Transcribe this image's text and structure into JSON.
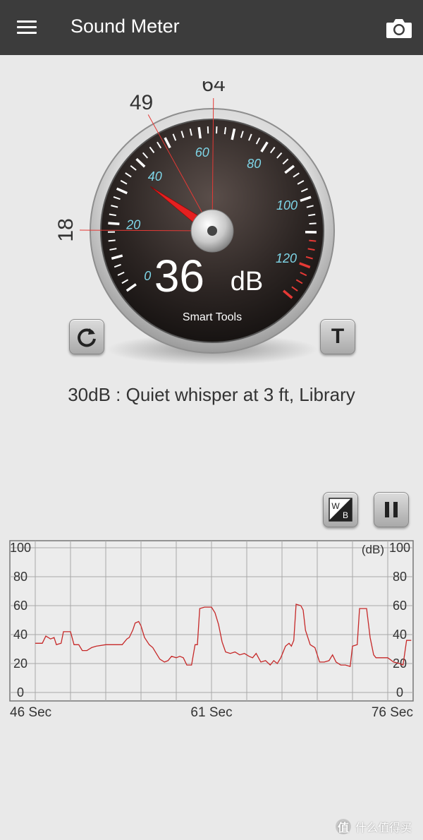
{
  "app_bar": {
    "title": "Sound Meter",
    "menu_icon": "hamburger-menu-icon",
    "camera_icon": "camera-icon"
  },
  "gauge": {
    "reading_value": "36",
    "reading_unit": "dB",
    "brand": "Smart Tools",
    "scale_labels": [
      "0",
      "20",
      "40",
      "60",
      "80",
      "100",
      "120"
    ],
    "min_marker": "18",
    "avg_marker": "49",
    "max_marker": "64",
    "needle_db": 36,
    "min_db": 18,
    "avg_db": 49,
    "max_db": 64,
    "needle_color": "#e52020",
    "scale_color": "#7fd6e8"
  },
  "buttons": {
    "reset_icon": "refresh-icon",
    "t_label": "T",
    "wb_top": "W",
    "wb_bottom": "B",
    "pause_icon": "pause-icon"
  },
  "status": {
    "description": "30dB : Quiet whisper at 3 ft, Library"
  },
  "chart_data": {
    "type": "line",
    "unit_label": "(dB)",
    "ylim": [
      0,
      100
    ],
    "y_ticks": [
      "0",
      "20",
      "40",
      "60",
      "80",
      "100"
    ],
    "x_labels": [
      "46 Sec",
      "61 Sec",
      "76 Sec"
    ],
    "xlim": [
      46,
      76
    ],
    "grid": true,
    "line_color": "#c62828",
    "series": [
      {
        "values": [
          [
            46.0,
            34
          ],
          [
            46.6,
            34
          ],
          [
            46.9,
            39
          ],
          [
            47.3,
            37
          ],
          [
            47.6,
            38
          ],
          [
            47.8,
            33
          ],
          [
            48.2,
            34
          ],
          [
            48.4,
            42
          ],
          [
            49.0,
            42
          ],
          [
            49.3,
            33
          ],
          [
            49.7,
            33
          ],
          [
            50.0,
            29
          ],
          [
            50.4,
            29
          ],
          [
            50.8,
            31
          ],
          [
            51.2,
            32
          ],
          [
            52.0,
            33
          ],
          [
            53.0,
            33
          ],
          [
            53.4,
            33
          ],
          [
            53.8,
            37
          ],
          [
            54.0,
            38
          ],
          [
            54.3,
            43
          ],
          [
            54.5,
            48
          ],
          [
            54.8,
            49
          ],
          [
            55.0,
            46
          ],
          [
            55.3,
            38
          ],
          [
            55.7,
            33
          ],
          [
            56.0,
            31
          ],
          [
            56.3,
            27
          ],
          [
            56.6,
            23
          ],
          [
            57.0,
            21
          ],
          [
            57.3,
            22
          ],
          [
            57.6,
            25
          ],
          [
            58.0,
            24
          ],
          [
            58.3,
            25
          ],
          [
            58.6,
            24
          ],
          [
            58.9,
            19
          ],
          [
            59.3,
            19
          ],
          [
            59.6,
            33
          ],
          [
            59.8,
            33
          ],
          [
            60.0,
            58
          ],
          [
            60.4,
            59
          ],
          [
            61.0,
            59
          ],
          [
            61.3,
            55
          ],
          [
            61.6,
            47
          ],
          [
            61.9,
            35
          ],
          [
            62.2,
            28
          ],
          [
            62.6,
            27
          ],
          [
            63.0,
            28
          ],
          [
            63.4,
            26
          ],
          [
            63.8,
            27
          ],
          [
            64.2,
            25
          ],
          [
            64.5,
            24
          ],
          [
            64.8,
            27
          ],
          [
            65.2,
            21
          ],
          [
            65.6,
            22
          ],
          [
            66.0,
            19
          ],
          [
            66.3,
            22
          ],
          [
            66.6,
            20
          ],
          [
            66.9,
            24
          ],
          [
            67.3,
            32
          ],
          [
            67.6,
            34
          ],
          [
            67.8,
            32
          ],
          [
            68.0,
            36
          ],
          [
            68.2,
            61
          ],
          [
            68.6,
            60
          ],
          [
            68.8,
            57
          ],
          [
            69.0,
            43
          ],
          [
            69.4,
            33
          ],
          [
            69.8,
            31
          ],
          [
            70.2,
            21
          ],
          [
            70.6,
            21
          ],
          [
            71.0,
            22
          ],
          [
            71.3,
            26
          ],
          [
            71.6,
            21
          ],
          [
            72.0,
            19
          ],
          [
            72.4,
            19
          ],
          [
            72.8,
            18
          ],
          [
            73.0,
            32
          ],
          [
            73.4,
            33
          ],
          [
            73.6,
            58
          ],
          [
            74.2,
            58
          ],
          [
            74.5,
            38
          ],
          [
            74.8,
            26
          ],
          [
            75.0,
            24
          ],
          [
            75.5,
            24
          ],
          [
            76.0,
            24
          ],
          [
            76.5,
            21
          ],
          [
            77.0,
            20
          ],
          [
            77.3,
            19
          ],
          [
            77.6,
            36
          ],
          [
            78.0,
            36
          ]
        ]
      }
    ]
  },
  "watermark": {
    "logo_char": "值",
    "text": "什么值得买"
  }
}
